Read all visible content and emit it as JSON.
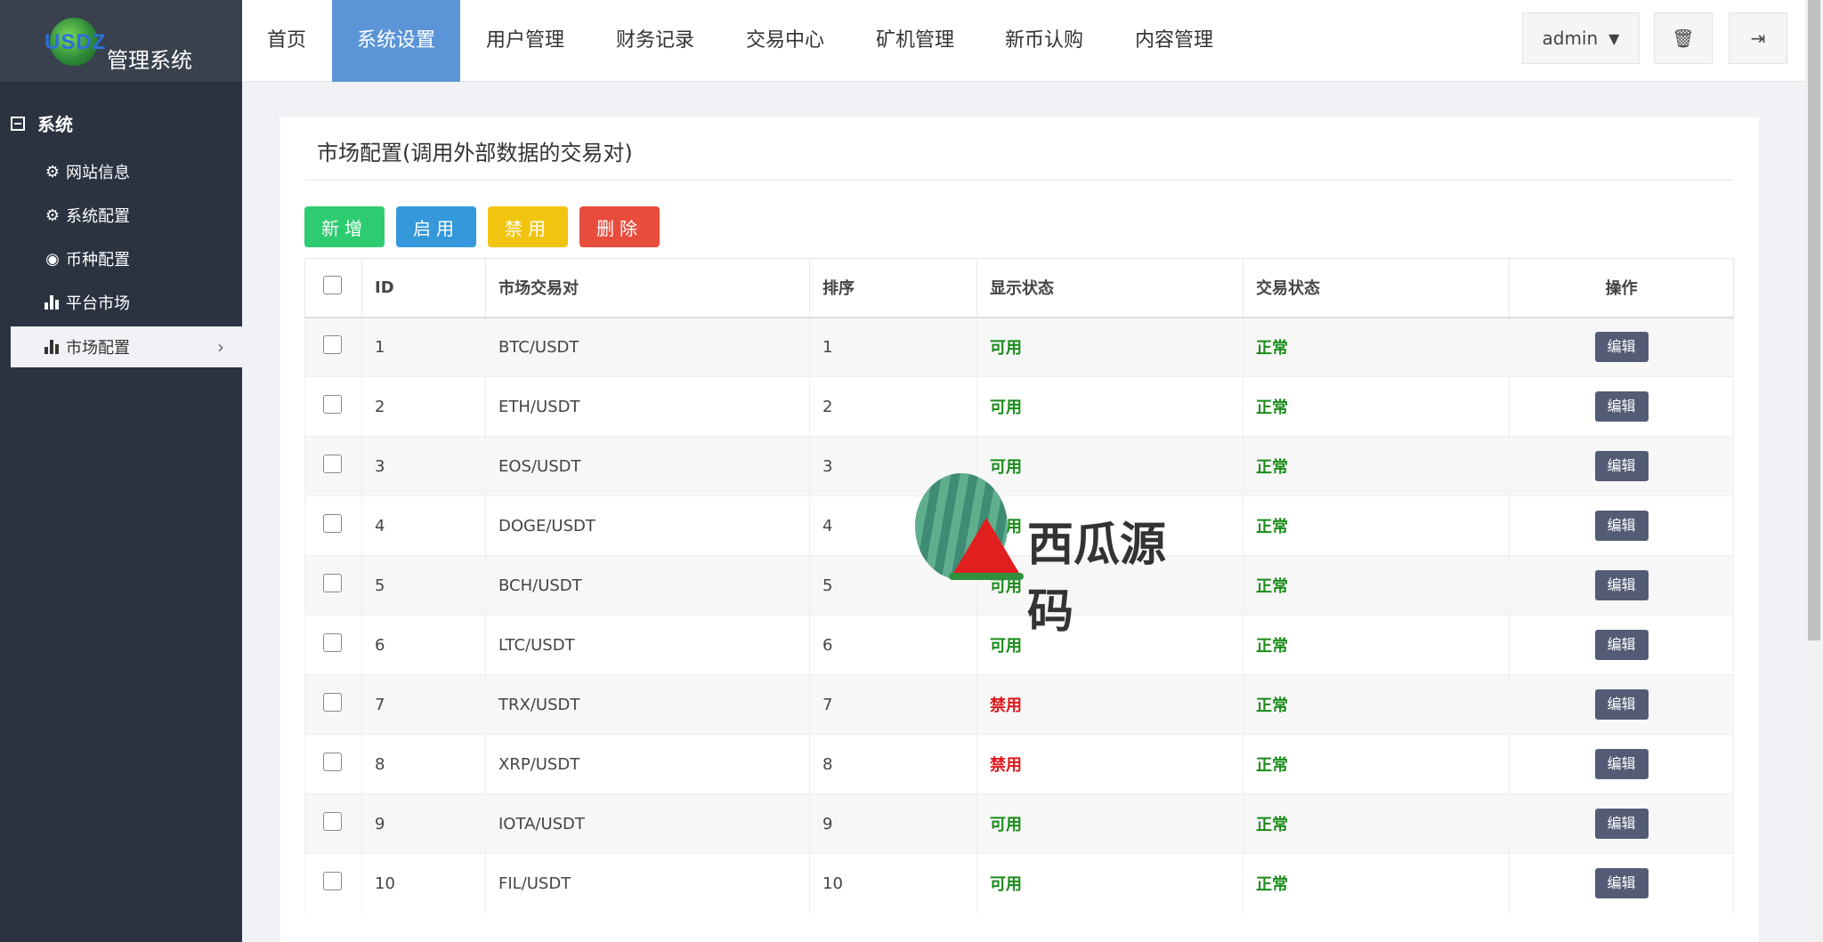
{
  "logo": {
    "brand": "USDZ",
    "title": "管理系统"
  },
  "sidebar": {
    "section": "系统",
    "items": [
      {
        "label": "网站信息",
        "icon": "gear-icon"
      },
      {
        "label": "系统配置",
        "icon": "gear-icon"
      },
      {
        "label": "币种配置",
        "icon": "dot-circle-icon"
      },
      {
        "label": "平台市场",
        "icon": "bar-chart-icon"
      },
      {
        "label": "市场配置",
        "icon": "bar-chart-icon",
        "active": true
      }
    ]
  },
  "topnav": {
    "items": [
      "首页",
      "系统设置",
      "用户管理",
      "财务记录",
      "交易中心",
      "矿机管理",
      "新币认购",
      "内容管理"
    ],
    "active_index": 1,
    "user": "admin"
  },
  "panel": {
    "title": "市场配置(调用外部数据的交易对)",
    "buttons": {
      "add": "新增",
      "enable": "启用",
      "disable": "禁用",
      "delete": "删除"
    }
  },
  "table": {
    "columns": [
      "ID",
      "市场交易对",
      "排序",
      "显示状态",
      "交易状态",
      "操作"
    ],
    "rows": [
      {
        "id": "1",
        "pair": "BTC/USDT",
        "sort": "1",
        "display": "可用",
        "trade": "正常",
        "action": "编辑"
      },
      {
        "id": "2",
        "pair": "ETH/USDT",
        "sort": "2",
        "display": "可用",
        "trade": "正常",
        "action": "编辑"
      },
      {
        "id": "3",
        "pair": "EOS/USDT",
        "sort": "3",
        "display": "可用",
        "trade": "正常",
        "action": "编辑"
      },
      {
        "id": "4",
        "pair": "DOGE/USDT",
        "sort": "4",
        "display": "可用",
        "trade": "正常",
        "action": "编辑"
      },
      {
        "id": "5",
        "pair": "BCH/USDT",
        "sort": "5",
        "display": "可用",
        "trade": "正常",
        "action": "编辑"
      },
      {
        "id": "6",
        "pair": "LTC/USDT",
        "sort": "6",
        "display": "可用",
        "trade": "正常",
        "action": "编辑"
      },
      {
        "id": "7",
        "pair": "TRX/USDT",
        "sort": "7",
        "display": "禁用",
        "trade": "正常",
        "action": "编辑"
      },
      {
        "id": "8",
        "pair": "XRP/USDT",
        "sort": "8",
        "display": "禁用",
        "trade": "正常",
        "action": "编辑"
      },
      {
        "id": "9",
        "pair": "IOTA/USDT",
        "sort": "9",
        "display": "可用",
        "trade": "正常",
        "action": "编辑"
      },
      {
        "id": "10",
        "pair": "FIL/USDT",
        "sort": "10",
        "display": "可用",
        "trade": "正常",
        "action": "编辑"
      }
    ]
  },
  "watermark": {
    "text": "西瓜源码"
  },
  "colors": {
    "accent": "#5b95d8",
    "sidebar": "#2b3240",
    "ok": "#1a8c1a",
    "bad": "#e0181b",
    "add": "#2ecc71",
    "enable": "#3498db",
    "disable": "#f1c40f",
    "delete": "#e74c3c"
  }
}
